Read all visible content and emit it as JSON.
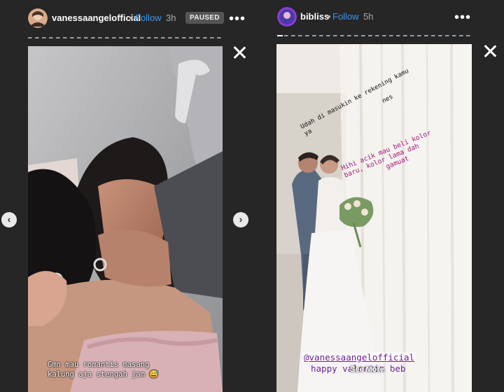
{
  "left_story": {
    "username": "vanessaangelofficial",
    "separator": "•",
    "follow_label": "Follow",
    "time": "3h",
    "status_badge": "PAUSED",
    "more_label": "•••",
    "prev_label": "‹",
    "next_label": "›",
    "caption_line1": "Gmn mau romantis masang",
    "caption_line2": "kalung aja stengah jam 😅"
  },
  "right_story": {
    "username": "bibliss",
    "separator": "•",
    "follow_label": "Follow",
    "time": "5h",
    "more_label": "•••",
    "annotation1_line1": "Udah di masukin ke rekening kamu ya",
    "annotation1_line2": "nes",
    "annotation2_line1": "Hihi acik mau beli kolor",
    "annotation2_line2": "baru, kolor lama dah",
    "annotation2_line3": "gamuat",
    "mention": "@vanessaangelofficial",
    "happy_text": "happy valentin beb",
    "see_more": "See More",
    "see_more_chevron": "›"
  },
  "colors": {
    "background": "#262626",
    "follow": "#3897f0",
    "mention": "#6a2296"
  }
}
